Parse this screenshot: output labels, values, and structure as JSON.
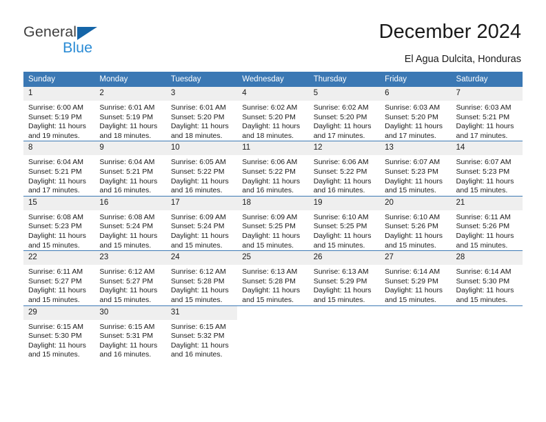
{
  "brand": {
    "name_top": "General",
    "name_bottom": "Blue",
    "logo_icon": "triangle-flag-icon"
  },
  "header": {
    "title": "December 2024",
    "location": "El Agua Dulcita, Honduras"
  },
  "calendar": {
    "weekday_headers": [
      "Sunday",
      "Monday",
      "Tuesday",
      "Wednesday",
      "Thursday",
      "Friday",
      "Saturday"
    ],
    "accent_color": "#3b78b4",
    "daynum_bg": "#efefef",
    "weeks": [
      [
        {
          "day": "1",
          "sunrise": "Sunrise: 6:00 AM",
          "sunset": "Sunset: 5:19 PM",
          "daylight_line1": "Daylight: 11 hours",
          "daylight_line2": "and 19 minutes."
        },
        {
          "day": "2",
          "sunrise": "Sunrise: 6:01 AM",
          "sunset": "Sunset: 5:19 PM",
          "daylight_line1": "Daylight: 11 hours",
          "daylight_line2": "and 18 minutes."
        },
        {
          "day": "3",
          "sunrise": "Sunrise: 6:01 AM",
          "sunset": "Sunset: 5:20 PM",
          "daylight_line1": "Daylight: 11 hours",
          "daylight_line2": "and 18 minutes."
        },
        {
          "day": "4",
          "sunrise": "Sunrise: 6:02 AM",
          "sunset": "Sunset: 5:20 PM",
          "daylight_line1": "Daylight: 11 hours",
          "daylight_line2": "and 18 minutes."
        },
        {
          "day": "5",
          "sunrise": "Sunrise: 6:02 AM",
          "sunset": "Sunset: 5:20 PM",
          "daylight_line1": "Daylight: 11 hours",
          "daylight_line2": "and 17 minutes."
        },
        {
          "day": "6",
          "sunrise": "Sunrise: 6:03 AM",
          "sunset": "Sunset: 5:20 PM",
          "daylight_line1": "Daylight: 11 hours",
          "daylight_line2": "and 17 minutes."
        },
        {
          "day": "7",
          "sunrise": "Sunrise: 6:03 AM",
          "sunset": "Sunset: 5:21 PM",
          "daylight_line1": "Daylight: 11 hours",
          "daylight_line2": "and 17 minutes."
        }
      ],
      [
        {
          "day": "8",
          "sunrise": "Sunrise: 6:04 AM",
          "sunset": "Sunset: 5:21 PM",
          "daylight_line1": "Daylight: 11 hours",
          "daylight_line2": "and 17 minutes."
        },
        {
          "day": "9",
          "sunrise": "Sunrise: 6:04 AM",
          "sunset": "Sunset: 5:21 PM",
          "daylight_line1": "Daylight: 11 hours",
          "daylight_line2": "and 16 minutes."
        },
        {
          "day": "10",
          "sunrise": "Sunrise: 6:05 AM",
          "sunset": "Sunset: 5:22 PM",
          "daylight_line1": "Daylight: 11 hours",
          "daylight_line2": "and 16 minutes."
        },
        {
          "day": "11",
          "sunrise": "Sunrise: 6:06 AM",
          "sunset": "Sunset: 5:22 PM",
          "daylight_line1": "Daylight: 11 hours",
          "daylight_line2": "and 16 minutes."
        },
        {
          "day": "12",
          "sunrise": "Sunrise: 6:06 AM",
          "sunset": "Sunset: 5:22 PM",
          "daylight_line1": "Daylight: 11 hours",
          "daylight_line2": "and 16 minutes."
        },
        {
          "day": "13",
          "sunrise": "Sunrise: 6:07 AM",
          "sunset": "Sunset: 5:23 PM",
          "daylight_line1": "Daylight: 11 hours",
          "daylight_line2": "and 15 minutes."
        },
        {
          "day": "14",
          "sunrise": "Sunrise: 6:07 AM",
          "sunset": "Sunset: 5:23 PM",
          "daylight_line1": "Daylight: 11 hours",
          "daylight_line2": "and 15 minutes."
        }
      ],
      [
        {
          "day": "15",
          "sunrise": "Sunrise: 6:08 AM",
          "sunset": "Sunset: 5:23 PM",
          "daylight_line1": "Daylight: 11 hours",
          "daylight_line2": "and 15 minutes."
        },
        {
          "day": "16",
          "sunrise": "Sunrise: 6:08 AM",
          "sunset": "Sunset: 5:24 PM",
          "daylight_line1": "Daylight: 11 hours",
          "daylight_line2": "and 15 minutes."
        },
        {
          "day": "17",
          "sunrise": "Sunrise: 6:09 AM",
          "sunset": "Sunset: 5:24 PM",
          "daylight_line1": "Daylight: 11 hours",
          "daylight_line2": "and 15 minutes."
        },
        {
          "day": "18",
          "sunrise": "Sunrise: 6:09 AM",
          "sunset": "Sunset: 5:25 PM",
          "daylight_line1": "Daylight: 11 hours",
          "daylight_line2": "and 15 minutes."
        },
        {
          "day": "19",
          "sunrise": "Sunrise: 6:10 AM",
          "sunset": "Sunset: 5:25 PM",
          "daylight_line1": "Daylight: 11 hours",
          "daylight_line2": "and 15 minutes."
        },
        {
          "day": "20",
          "sunrise": "Sunrise: 6:10 AM",
          "sunset": "Sunset: 5:26 PM",
          "daylight_line1": "Daylight: 11 hours",
          "daylight_line2": "and 15 minutes."
        },
        {
          "day": "21",
          "sunrise": "Sunrise: 6:11 AM",
          "sunset": "Sunset: 5:26 PM",
          "daylight_line1": "Daylight: 11 hours",
          "daylight_line2": "and 15 minutes."
        }
      ],
      [
        {
          "day": "22",
          "sunrise": "Sunrise: 6:11 AM",
          "sunset": "Sunset: 5:27 PM",
          "daylight_line1": "Daylight: 11 hours",
          "daylight_line2": "and 15 minutes."
        },
        {
          "day": "23",
          "sunrise": "Sunrise: 6:12 AM",
          "sunset": "Sunset: 5:27 PM",
          "daylight_line1": "Daylight: 11 hours",
          "daylight_line2": "and 15 minutes."
        },
        {
          "day": "24",
          "sunrise": "Sunrise: 6:12 AM",
          "sunset": "Sunset: 5:28 PM",
          "daylight_line1": "Daylight: 11 hours",
          "daylight_line2": "and 15 minutes."
        },
        {
          "day": "25",
          "sunrise": "Sunrise: 6:13 AM",
          "sunset": "Sunset: 5:28 PM",
          "daylight_line1": "Daylight: 11 hours",
          "daylight_line2": "and 15 minutes."
        },
        {
          "day": "26",
          "sunrise": "Sunrise: 6:13 AM",
          "sunset": "Sunset: 5:29 PM",
          "daylight_line1": "Daylight: 11 hours",
          "daylight_line2": "and 15 minutes."
        },
        {
          "day": "27",
          "sunrise": "Sunrise: 6:14 AM",
          "sunset": "Sunset: 5:29 PM",
          "daylight_line1": "Daylight: 11 hours",
          "daylight_line2": "and 15 minutes."
        },
        {
          "day": "28",
          "sunrise": "Sunrise: 6:14 AM",
          "sunset": "Sunset: 5:30 PM",
          "daylight_line1": "Daylight: 11 hours",
          "daylight_line2": "and 15 minutes."
        }
      ],
      [
        {
          "day": "29",
          "sunrise": "Sunrise: 6:15 AM",
          "sunset": "Sunset: 5:30 PM",
          "daylight_line1": "Daylight: 11 hours",
          "daylight_line2": "and 15 minutes."
        },
        {
          "day": "30",
          "sunrise": "Sunrise: 6:15 AM",
          "sunset": "Sunset: 5:31 PM",
          "daylight_line1": "Daylight: 11 hours",
          "daylight_line2": "and 16 minutes."
        },
        {
          "day": "31",
          "sunrise": "Sunrise: 6:15 AM",
          "sunset": "Sunset: 5:32 PM",
          "daylight_line1": "Daylight: 11 hours",
          "daylight_line2": "and 16 minutes."
        },
        {
          "day": "",
          "sunrise": "",
          "sunset": "",
          "daylight_line1": "",
          "daylight_line2": ""
        },
        {
          "day": "",
          "sunrise": "",
          "sunset": "",
          "daylight_line1": "",
          "daylight_line2": ""
        },
        {
          "day": "",
          "sunrise": "",
          "sunset": "",
          "daylight_line1": "",
          "daylight_line2": ""
        },
        {
          "day": "",
          "sunrise": "",
          "sunset": "",
          "daylight_line1": "",
          "daylight_line2": ""
        }
      ]
    ]
  }
}
